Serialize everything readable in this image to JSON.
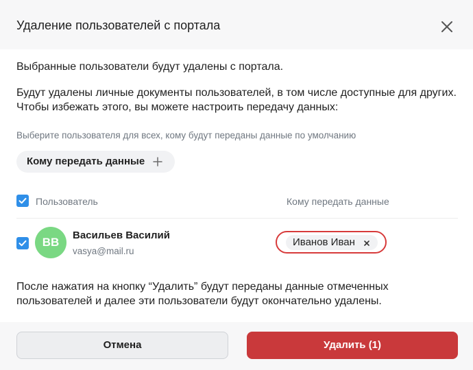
{
  "dialog": {
    "title": "Удаление пользователей с портала",
    "close_icon": "close-icon"
  },
  "body": {
    "line1": "Выбранные пользователи будут удалены с портала.",
    "line2": "Будут удалены личные документы пользователей, в том числе доступные для других.",
    "line3": "Чтобы избежать этого, вы можете настроить передачу данных:",
    "hint": "Выберите пользователя для всех, кому будут переданы данные по умолчанию",
    "assign_button": "Кому передать данные"
  },
  "table": {
    "columns": [
      "Пользователь",
      "Кому передать данные"
    ],
    "rows": [
      {
        "checked": true,
        "initials": "ВВ",
        "name": "Васильев Василий",
        "email": "vasya@mail.ru",
        "target": "Иванов Иван"
      }
    ]
  },
  "after_text": "После нажатия на кнопку “Удалить” будут переданы данные отмеченных пользователей и далее эти пользователи будут окончательно удалены.",
  "footer": {
    "cancel": "Отмена",
    "delete": "Удалить (1)"
  },
  "colors": {
    "accent": "#2f8fe8",
    "danger": "#c9393b",
    "avatar": "#7ad883"
  }
}
